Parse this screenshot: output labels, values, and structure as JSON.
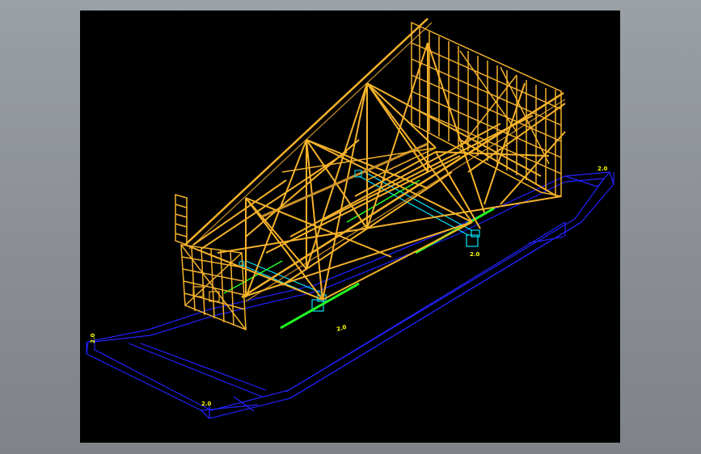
{
  "dimension_labels": {
    "label_1": "2.0",
    "label_2": "2.0",
    "label_3": "2.0",
    "label_4": "2.0",
    "label_5": "2.0"
  },
  "colors": {
    "viewport_bg": "#000000",
    "frame_bg": "#8c9096",
    "truss": "#f5b22a",
    "truss_dark": "#c9902a",
    "barge_outline": "#2222ff",
    "support_cyan": "#00e5ff",
    "rail_green": "#22ff22",
    "dimension_text": "#ffff00"
  }
}
